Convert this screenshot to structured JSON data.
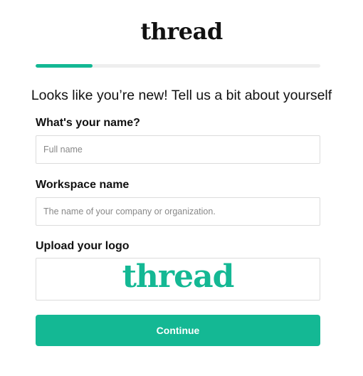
{
  "header": {
    "brand": "thread"
  },
  "progress": {
    "fraction": 0.2,
    "color": "#14b894"
  },
  "form": {
    "heading": "Looks like you’re new! Tell us a bit about yourself",
    "name": {
      "label": "What's your name?",
      "placeholder": "Full name",
      "value": ""
    },
    "workspace": {
      "label": "Workspace name",
      "placeholder": "The name of your company or organization.",
      "value": ""
    },
    "logo": {
      "label": "Upload your logo",
      "preview_text": "thread",
      "preview_color": "#14b894"
    },
    "continue_label": "Continue"
  },
  "colors": {
    "accent": "#14b894",
    "text": "#111111",
    "border": "#dcdcdc"
  }
}
